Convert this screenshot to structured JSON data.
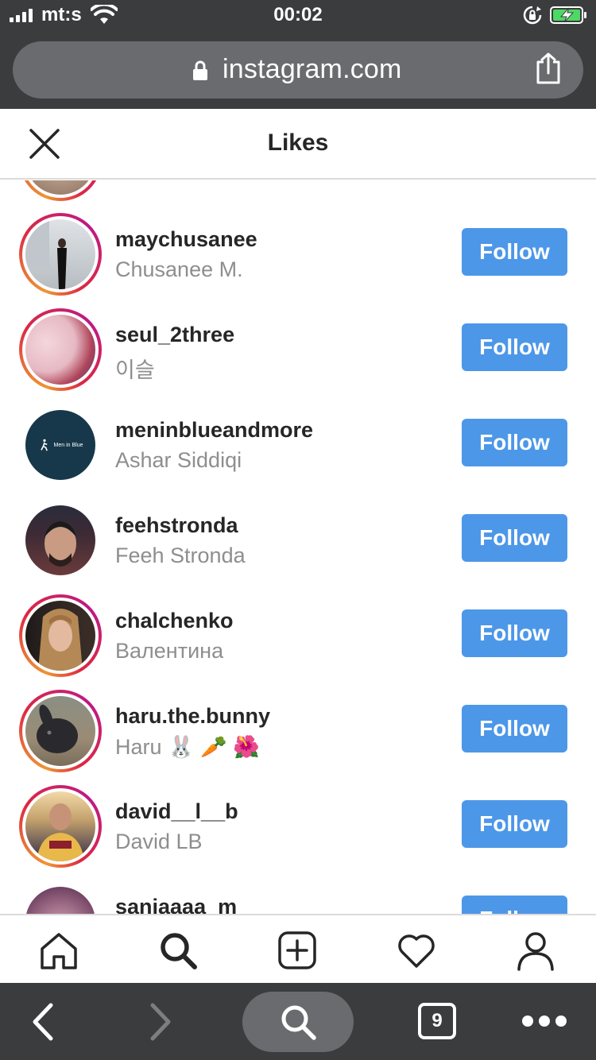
{
  "status_bar": {
    "carrier": "mt:s",
    "time": "00:02"
  },
  "browser": {
    "url": "instagram.com",
    "tab_count": "9"
  },
  "header": {
    "title": "Likes"
  },
  "likes": [
    {
      "username": "maychusanee",
      "full_name": "Chusanee M.",
      "button": "Follow",
      "story_ring": true
    },
    {
      "username": "seul_2three",
      "full_name": "이슬",
      "button": "Follow",
      "story_ring": true
    },
    {
      "username": "meninblueandmore",
      "full_name": "Ashar Siddiqi",
      "button": "Follow",
      "story_ring": false,
      "avatar_text": "Men in Blue"
    },
    {
      "username": "feehstronda",
      "full_name": "Feeh Stronda",
      "button": "Follow",
      "story_ring": false
    },
    {
      "username": "chalchenko",
      "full_name": "Валентина",
      "button": "Follow",
      "story_ring": true
    },
    {
      "username": "haru.the.bunny",
      "full_name": "Haru 🐰 🥕 🌺",
      "button": "Follow",
      "story_ring": true
    },
    {
      "username": "david__l__b",
      "full_name": "David LB",
      "button": "Follow",
      "story_ring": true
    },
    {
      "username": "sanjaaaa_m",
      "full_name": "",
      "button": "Follow",
      "story_ring": false
    }
  ],
  "nav": [
    "home-icon",
    "search-icon",
    "new-post-icon",
    "activity-heart-icon",
    "profile-icon"
  ],
  "colors": {
    "follow_button": "#4d97e8",
    "browser_chrome": "#3b3c3e",
    "url_pill": "#6a6b6e",
    "secondary_text": "#8e8e8e",
    "battery_fill": "#4cd964"
  }
}
